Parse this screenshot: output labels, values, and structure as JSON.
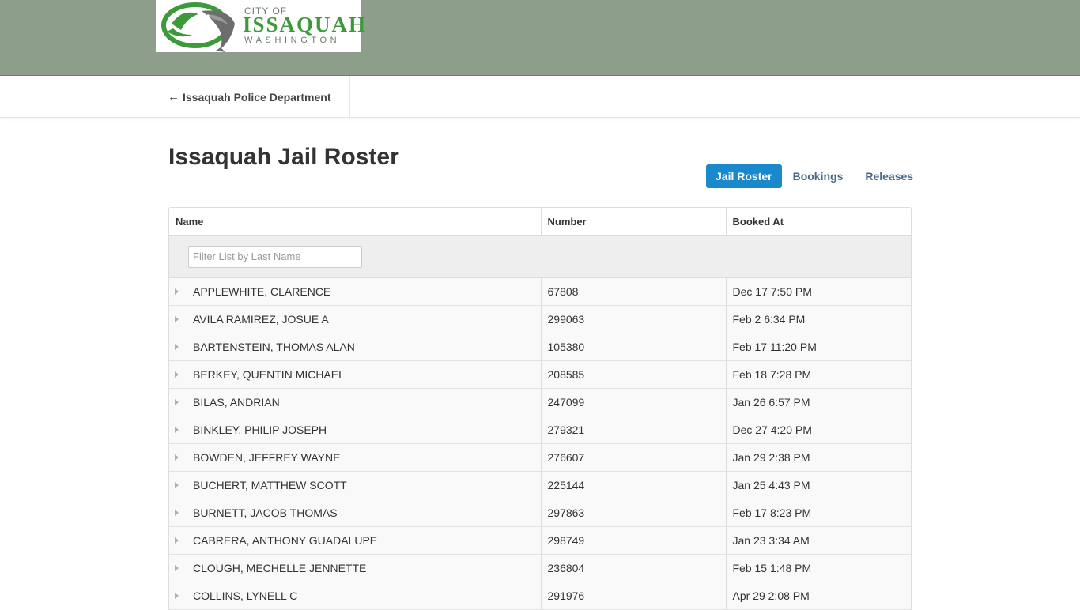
{
  "logo": {
    "line1": "CITY OF",
    "line2": "ISSAQUAH",
    "line3": "WASHINGTON"
  },
  "subnav": {
    "back_arrow": "←",
    "back_label": "Issaquah Police Department"
  },
  "page": {
    "title": "Issaquah Jail Roster"
  },
  "tabs": [
    {
      "label": "Jail Roster",
      "active": true
    },
    {
      "label": "Bookings",
      "active": false
    },
    {
      "label": "Releases",
      "active": false
    }
  ],
  "table": {
    "columns": [
      "Name",
      "Number",
      "Booked At"
    ],
    "filter_placeholder": "Filter List by Last Name",
    "rows": [
      {
        "name": "APPLEWHITE, CLARENCE",
        "number": "67808",
        "booked": "Dec 17 7:50 PM"
      },
      {
        "name": "AVILA RAMIREZ, JOSUE A",
        "number": "299063",
        "booked": "Feb 2 6:34 PM"
      },
      {
        "name": "BARTENSTEIN, THOMAS ALAN",
        "number": "105380",
        "booked": "Feb 17 11:20 PM"
      },
      {
        "name": "BERKEY, QUENTIN MICHAEL",
        "number": "208585",
        "booked": "Feb 18 7:28 PM"
      },
      {
        "name": "BILAS, ANDRIAN",
        "number": "247099",
        "booked": "Jan 26 6:57 PM"
      },
      {
        "name": "BINKLEY, PHILIP JOSEPH",
        "number": "279321",
        "booked": "Dec 27 4:20 PM"
      },
      {
        "name": "BOWDEN, JEFFREY WAYNE",
        "number": "276607",
        "booked": "Jan 29 2:38 PM"
      },
      {
        "name": "BUCHERT, MATTHEW SCOTT",
        "number": "225144",
        "booked": "Jan 25 4:43 PM"
      },
      {
        "name": "BURNETT, JACOB THOMAS",
        "number": "297863",
        "booked": "Feb 17 8:23 PM"
      },
      {
        "name": "CABRERA, ANTHONY GUADALUPE",
        "number": "298749",
        "booked": "Jan 23 3:34 AM"
      },
      {
        "name": "CLOUGH, MECHELLE JENNETTE",
        "number": "236804",
        "booked": "Feb 15 1:48 PM"
      },
      {
        "name": "COLLINS, LYNELL C",
        "number": "291976",
        "booked": "Apr 29 2:08 PM"
      }
    ]
  },
  "colors": {
    "banner": "#8d9e8a",
    "accent": "#1a89cc",
    "logo_green": "#3d9a3a"
  }
}
